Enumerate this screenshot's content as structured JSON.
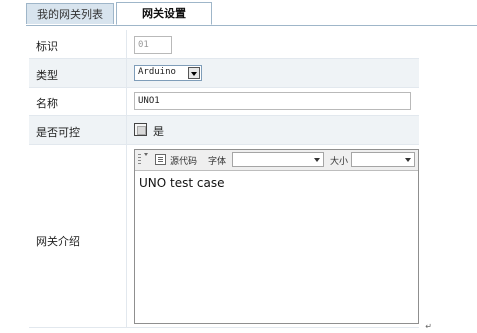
{
  "tabs": [
    {
      "label": "我的网关列表",
      "active": false
    },
    {
      "label": "网关设置",
      "active": true
    }
  ],
  "form": {
    "identifier": {
      "label": "标识",
      "value": "01"
    },
    "type": {
      "label": "类型",
      "value": "Arduino"
    },
    "name": {
      "label": "名称",
      "value": "UNO1"
    },
    "controllable": {
      "label": "是否可控",
      "checkbox_label": "是",
      "checked": false
    },
    "description": {
      "label": "网关介绍"
    }
  },
  "editor": {
    "source_label": "源代码",
    "font_label": "字体",
    "font_value": "",
    "size_label": "大小",
    "size_value": "",
    "content": "UNO test case"
  },
  "colors": {
    "accent": "#9fb6c9",
    "row_alt": "#eff3f6"
  }
}
